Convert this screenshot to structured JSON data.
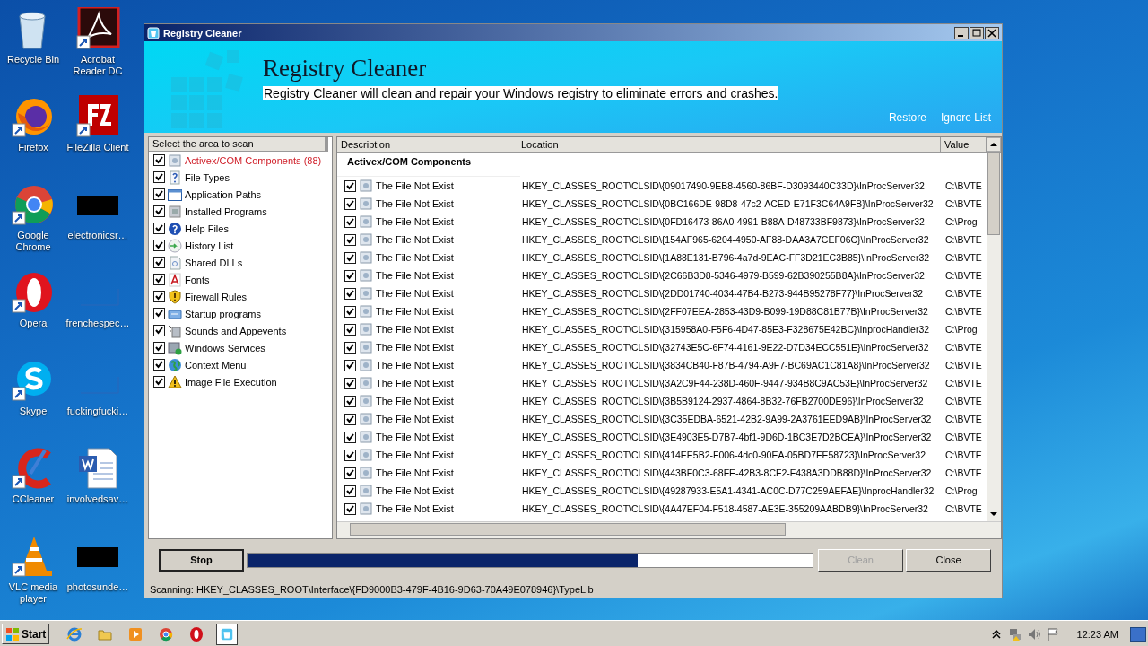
{
  "desktop_icons": [
    {
      "label": "Recycle Bin",
      "kind": "recycle"
    },
    {
      "label": "Acrobat Reader DC",
      "kind": "acrobat"
    },
    {
      "label": "Firefox",
      "kind": "firefox"
    },
    {
      "label": "FileZilla Client",
      "kind": "filezilla"
    },
    {
      "label": "Google Chrome",
      "kind": "chrome"
    },
    {
      "label": "electronicsr…",
      "kind": "black"
    },
    {
      "label": "Opera",
      "kind": "opera"
    },
    {
      "label": "frenchespec…",
      "kind": "blank"
    },
    {
      "label": "Skype",
      "kind": "skype"
    },
    {
      "label": "fuckingfucki…",
      "kind": "blank"
    },
    {
      "label": "CCleaner",
      "kind": "ccleaner"
    },
    {
      "label": "involvedsav…",
      "kind": "word"
    },
    {
      "label": "VLC media player",
      "kind": "vlc"
    },
    {
      "label": "photosunde…",
      "kind": "black"
    }
  ],
  "window": {
    "title": "Registry Cleaner",
    "banner": {
      "heading": "Registry Cleaner",
      "subtitle": "Registry Cleaner will clean and repair your Windows registry to eliminate errors and crashes.",
      "links": [
        "Restore",
        "Ignore List"
      ]
    },
    "scan_areas": {
      "header": "Select the area to scan",
      "items": [
        {
          "label": "Activex/COM Components (88)",
          "kind": "com",
          "checked": true,
          "highlighted": true
        },
        {
          "label": "File Types",
          "kind": "question",
          "checked": true,
          "highlighted": false
        },
        {
          "label": "Application Paths",
          "kind": "window",
          "checked": true,
          "highlighted": false
        },
        {
          "label": "Installed Programs",
          "kind": "programs",
          "checked": true,
          "highlighted": false
        },
        {
          "label": "Help Files",
          "kind": "help",
          "checked": true,
          "highlighted": false
        },
        {
          "label": "History List",
          "kind": "history",
          "checked": true,
          "highlighted": false
        },
        {
          "label": "Shared DLLs",
          "kind": "dll",
          "checked": true,
          "highlighted": false
        },
        {
          "label": "Fonts",
          "kind": "font",
          "checked": true,
          "highlighted": false
        },
        {
          "label": "Firewall Rules",
          "kind": "shield",
          "checked": true,
          "highlighted": false
        },
        {
          "label": "Startup programs",
          "kind": "startup",
          "checked": true,
          "highlighted": false
        },
        {
          "label": "Sounds and Appevents",
          "kind": "sound",
          "checked": true,
          "highlighted": false
        },
        {
          "label": "Windows Services",
          "kind": "services",
          "checked": true,
          "highlighted": false
        },
        {
          "label": "Context Menu",
          "kind": "globe",
          "checked": true,
          "highlighted": false
        },
        {
          "label": "Image File Execution",
          "kind": "warning",
          "checked": true,
          "highlighted": false
        }
      ]
    },
    "table": {
      "columns": [
        "Description",
        "Location",
        "Value"
      ],
      "group": "Activex/COM Components",
      "rows": [
        {
          "description": "The File Not Exist",
          "location": "HKEY_CLASSES_ROOT\\CLSID\\{09017490-9EB8-4560-86BF-D3093440C33D}\\InProcServer32",
          "value": "C:\\BVTE",
          "checked": true
        },
        {
          "description": "The File Not Exist",
          "location": "HKEY_CLASSES_ROOT\\CLSID\\{0BC166DE-98D8-47c2-ACED-E71F3C64A9FB}\\InProcServer32",
          "value": "C:\\BVTE",
          "checked": true
        },
        {
          "description": "The File Not Exist",
          "location": "HKEY_CLASSES_ROOT\\CLSID\\{0FD16473-86A0-4991-B88A-D48733BF9873}\\InProcServer32",
          "value": "C:\\Prog",
          "checked": true
        },
        {
          "description": "The File Not Exist",
          "location": "HKEY_CLASSES_ROOT\\CLSID\\{154AF965-6204-4950-AF88-DAA3A7CEF06C}\\InProcServer32",
          "value": "C:\\BVTE",
          "checked": true
        },
        {
          "description": "The File Not Exist",
          "location": "HKEY_CLASSES_ROOT\\CLSID\\{1A88E131-B796-4a7d-9EAC-FF3D21EC3B85}\\InProcServer32",
          "value": "C:\\BVTE",
          "checked": true
        },
        {
          "description": "The File Not Exist",
          "location": "HKEY_CLASSES_ROOT\\CLSID\\{2C66B3D8-5346-4979-B599-62B390255B8A}\\InProcServer32",
          "value": "C:\\BVTE",
          "checked": true
        },
        {
          "description": "The File Not Exist",
          "location": "HKEY_CLASSES_ROOT\\CLSID\\{2DD01740-4034-47B4-B273-944B95278F77}\\InProcServer32",
          "value": "C:\\BVTE",
          "checked": true
        },
        {
          "description": "The File Not Exist",
          "location": "HKEY_CLASSES_ROOT\\CLSID\\{2FF07EEA-2853-43D9-B099-19D88C81B77B}\\InProcServer32",
          "value": "C:\\BVTE",
          "checked": true
        },
        {
          "description": "The File Not Exist",
          "location": "HKEY_CLASSES_ROOT\\CLSID\\{315958A0-F5F6-4D47-85E3-F328675E42BC}\\InprocHandler32",
          "value": "C:\\Prog",
          "checked": true
        },
        {
          "description": "The File Not Exist",
          "location": "HKEY_CLASSES_ROOT\\CLSID\\{32743E5C-6F74-4161-9E22-D7D34ECC551E}\\InProcServer32",
          "value": "C:\\BVTE",
          "checked": true
        },
        {
          "description": "The File Not Exist",
          "location": "HKEY_CLASSES_ROOT\\CLSID\\{3834CB40-F87B-4794-A9F7-BC69AC1C81A8}\\InProcServer32",
          "value": "C:\\BVTE",
          "checked": true
        },
        {
          "description": "The File Not Exist",
          "location": "HKEY_CLASSES_ROOT\\CLSID\\{3A2C9F44-238D-460F-9447-934B8C9AC53E}\\InProcServer32",
          "value": "C:\\BVTE",
          "checked": true
        },
        {
          "description": "The File Not Exist",
          "location": "HKEY_CLASSES_ROOT\\CLSID\\{3B5B9124-2937-4864-8B32-76FB2700DE96}\\InProcServer32",
          "value": "C:\\BVTE",
          "checked": true
        },
        {
          "description": "The File Not Exist",
          "location": "HKEY_CLASSES_ROOT\\CLSID\\{3C35EDBA-6521-42B2-9A99-2A3761EED9AB}\\InProcServer32",
          "value": "C:\\BVTE",
          "checked": true
        },
        {
          "description": "The File Not Exist",
          "location": "HKEY_CLASSES_ROOT\\CLSID\\{3E4903E5-D7B7-4bf1-9D6D-1BC3E7D2BCEA}\\InProcServer32",
          "value": "C:\\BVTE",
          "checked": true
        },
        {
          "description": "The File Not Exist",
          "location": "HKEY_CLASSES_ROOT\\CLSID\\{414EE5B2-F006-4dc0-90EA-05BD7FE58723}\\InProcServer32",
          "value": "C:\\BVTE",
          "checked": true
        },
        {
          "description": "The File Not Exist",
          "location": "HKEY_CLASSES_ROOT\\CLSID\\{443BF0C3-68FE-42B3-8CF2-F438A3DDB88D}\\InProcServer32",
          "value": "C:\\BVTE",
          "checked": true
        },
        {
          "description": "The File Not Exist",
          "location": "HKEY_CLASSES_ROOT\\CLSID\\{49287933-E5A1-4341-AC0C-D77C259AEFAE}\\InprocHandler32",
          "value": "C:\\Prog",
          "checked": true
        },
        {
          "description": "The File Not Exist",
          "location": "HKEY_CLASSES_ROOT\\CLSID\\{4A47EF04-F518-4587-AE3E-355209AABDB9}\\InProcServer32",
          "value": "C:\\BVTE",
          "checked": true
        }
      ]
    },
    "actions": {
      "stop": "Stop",
      "progress": {
        "level": 0.69
      },
      "clean": {
        "label": "Clean",
        "disabled": true
      },
      "close": {
        "label": "Close",
        "disabled": false
      }
    },
    "status_bar": "Scanning: HKEY_CLASSES_ROOT\\Interface\\{FD9000B3-479F-4B16-9D63-70A49E078946}\\TypeLib"
  },
  "taskbar": {
    "start": "Start",
    "apps": [
      {
        "kind": "ie",
        "selected": false
      },
      {
        "kind": "folder",
        "selected": false
      },
      {
        "kind": "media",
        "selected": false
      },
      {
        "kind": "chrome",
        "selected": false
      },
      {
        "kind": "opera",
        "selected": false
      },
      {
        "kind": "cleaner",
        "selected": true
      }
    ],
    "clock": "12:23 AM"
  }
}
